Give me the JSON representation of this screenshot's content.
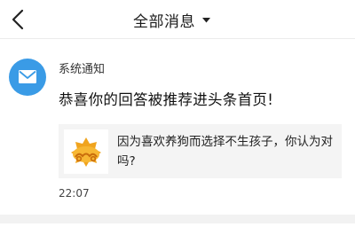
{
  "header": {
    "title": "全部消息",
    "back_icon": "chevron-left-icon",
    "dropdown_icon": "caret-down-icon"
  },
  "notification": {
    "avatar_icon": "envelope-icon",
    "avatar_color": "#3a9be6",
    "sender": "系统通知",
    "message": "恭喜你的回答被推荐进头条首页!",
    "quoted": {
      "thumbnail_icon": "golden-cloud-icon",
      "question": "因为喜欢养狗而选择不生孩子，你认为对吗?"
    },
    "time": "22:07"
  }
}
